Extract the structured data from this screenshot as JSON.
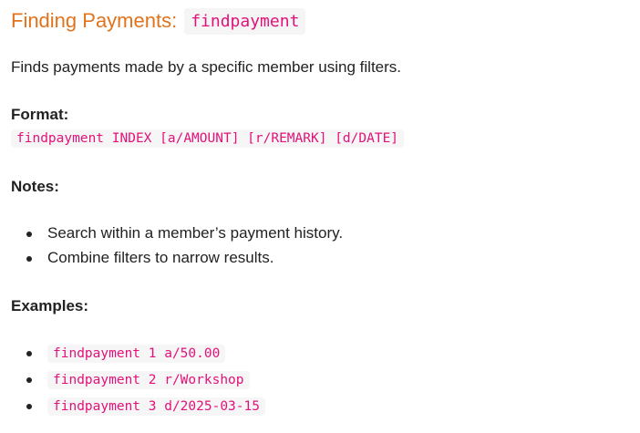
{
  "heading": {
    "title": "Finding Payments:",
    "command": "findpayment"
  },
  "description": "Finds payments made by a specific member using filters.",
  "format": {
    "label": "Format:",
    "code": "findpayment INDEX [a/AMOUNT] [r/REMARK] [d/DATE]"
  },
  "notes": {
    "label": "Notes:",
    "items": [
      "Search within a member’s payment history.",
      "Combine filters to narrow results."
    ]
  },
  "examples": {
    "label": "Examples:",
    "items": [
      "findpayment 1 a/50.00",
      "findpayment 2 r/Workshop",
      "findpayment 3 d/2025-03-15"
    ]
  }
}
